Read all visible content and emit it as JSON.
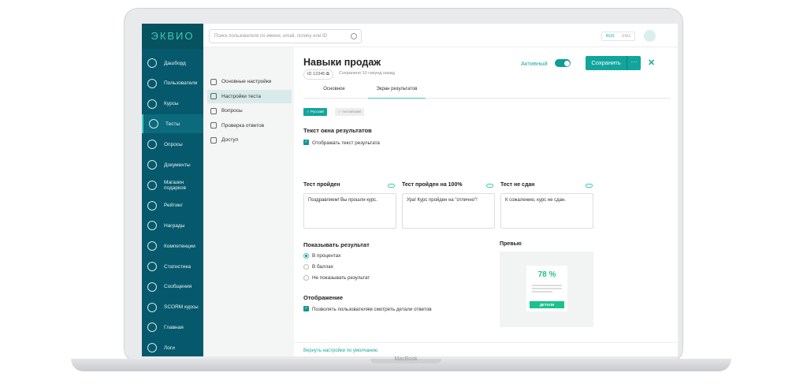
{
  "device": {
    "label": "MacBook"
  },
  "brand": {
    "logo": "ЭКВИО",
    "accent": "#12a59c",
    "sidebar_bg": "#06596c"
  },
  "sidebar": {
    "items": [
      {
        "label": "Дашборд",
        "icon": "chart-icon"
      },
      {
        "label": "Пользователи",
        "icon": "users-icon"
      },
      {
        "label": "Курсы",
        "icon": "graduation-cap-icon"
      },
      {
        "label": "Тесты",
        "icon": "grid-icon",
        "active": true
      },
      {
        "label": "Опросы",
        "icon": "trophy-icon"
      },
      {
        "label": "Документы",
        "icon": "info-icon"
      },
      {
        "label": "Магазин подарков",
        "icon": "gift-icon"
      },
      {
        "label": "Рейтинг",
        "icon": "trophy-icon"
      },
      {
        "label": "Награды",
        "icon": "medal-icon"
      },
      {
        "label": "Компетенции",
        "icon": "competence-icon"
      },
      {
        "label": "Статистика",
        "icon": "bar-chart-icon"
      },
      {
        "label": "Сообщения",
        "icon": "message-icon"
      },
      {
        "label": "SCORM курсы",
        "icon": "scorm-icon"
      },
      {
        "label": "Главная",
        "icon": "home-icon"
      },
      {
        "label": "Логи",
        "icon": "history-icon"
      }
    ]
  },
  "topbar": {
    "search_placeholder": "Поиск пользователя по имени, email, логину или ID",
    "lang": [
      "RUS",
      "ENG"
    ],
    "active_lang": "RUS"
  },
  "submenu": {
    "items": [
      {
        "label": "Основные настройки",
        "icon": "sliders-icon"
      },
      {
        "label": "Настройки теста",
        "icon": "grid-icon",
        "active": true
      },
      {
        "label": "Вопросы",
        "icon": "list-check-icon"
      },
      {
        "label": "Проверка ответов",
        "icon": "check-circle-icon"
      },
      {
        "label": "Доступ",
        "icon": "key-icon"
      }
    ]
  },
  "header": {
    "title": "Навыки продаж",
    "id": "ID 12345",
    "saved": "Сохранено 10 секунд назад",
    "status_label": "Активный",
    "status_on": true,
    "save": "Сохранить",
    "more": "···",
    "close": "✕"
  },
  "tabs": [
    {
      "label": "Основное"
    },
    {
      "label": "Экран результатов",
      "active": true
    }
  ],
  "languages": [
    {
      "label": "✓ Русский",
      "active": true
    },
    {
      "label": "✓ Английский",
      "active": false
    }
  ],
  "result_text": {
    "heading": "Текст окна результатов",
    "show_label": "Отображать текст результата",
    "show_checked": true,
    "fields": [
      {
        "label": "Тест пройден",
        "value": "Поздравляем! Вы прошли курс."
      },
      {
        "label": "Тест пройден на 100%",
        "value": "Ура! Курс пройден на \"отлично\"!"
      },
      {
        "label": "Тест не сдан",
        "value": "К сожалению, курс не сдан."
      }
    ]
  },
  "show_result": {
    "heading": "Показывать результат",
    "options": [
      "В процентах",
      "В баллах",
      "Не показывать результат"
    ],
    "selected": 0
  },
  "display": {
    "heading": "Отображение",
    "allow_label": "Позволять пользователям смотреть детали ответов",
    "allow_checked": true
  },
  "preview": {
    "heading": "Превью",
    "percent": "78 %",
    "button": "ДЕТАЛИ"
  },
  "footer": {
    "reset": "Вернуть настройки по умолчанию"
  }
}
